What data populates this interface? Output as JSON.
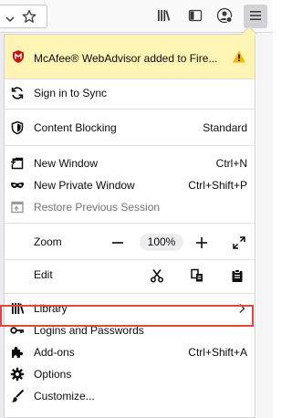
{
  "toolbar": {
    "buttons": [
      {
        "name": "library-icon"
      },
      {
        "name": "sidebar-icon"
      },
      {
        "name": "account-icon"
      },
      {
        "name": "hamburger-menu-icon"
      }
    ]
  },
  "banner": {
    "text": "McAfee® WebAdvisor added to Fire...",
    "icon": "mcafee-shield-icon",
    "warning_icon": "warning-icon"
  },
  "menu": {
    "sign_in": "Sign in to Sync",
    "content_blocking": {
      "label": "Content Blocking",
      "value": "Standard"
    },
    "new_window": {
      "label": "New Window",
      "shortcut": "Ctrl+N"
    },
    "new_private_window": {
      "label": "New Private Window",
      "shortcut": "Ctrl+Shift+P"
    },
    "restore_session": "Restore Previous Session",
    "zoom": {
      "label": "Zoom",
      "minus": "—",
      "value": "100%",
      "plus": "+"
    },
    "edit": {
      "label": "Edit"
    },
    "library": "Library",
    "logins": "Logins and Passwords",
    "addons": {
      "label": "Add-ons",
      "shortcut": "Ctrl+Shift+A"
    },
    "options": "Options",
    "customize": "Customize..."
  },
  "colors": {
    "banner_bg": "#fff4b3",
    "highlight": "#e0463e",
    "mcafee_red": "#c01818",
    "warning": "#f7b500"
  }
}
